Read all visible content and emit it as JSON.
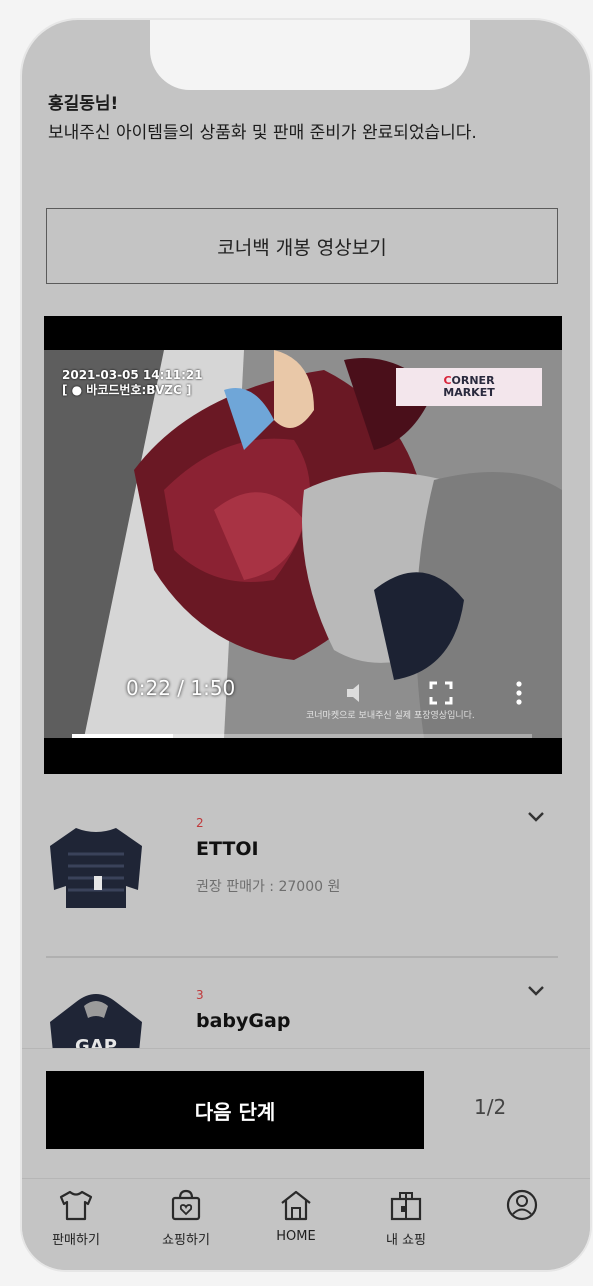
{
  "greeting": {
    "name": "홍길동님!",
    "message": "보내주신 아이템들의 상품화 및 판매 준비가 완료되었습니다."
  },
  "video_link_label": "코너백 개봉 영상보기",
  "video": {
    "timestamp": "2021-03-05 14:11:21",
    "barcode": "[ ● 바코드번호:BVZC ]",
    "brand_first": "C",
    "brand_rest": "ORNER",
    "brand_second": "MARKET",
    "time": "0:22 / 1:50",
    "caption": "코너마켓으로 보내주신 실제 포장영상입니다.",
    "progress": 0.22
  },
  "items": [
    {
      "number": "2",
      "brand": "ETTOI",
      "price": "권장 판매가 : 27000 원"
    },
    {
      "number": "3",
      "brand": "babyGap"
    }
  ],
  "next_button_label": "다음 단계",
  "page_indicator": "1/2",
  "tabs": [
    {
      "label": "판매하기",
      "icon": "tshirt-icon"
    },
    {
      "label": "쇼핑하기",
      "icon": "shopping-bag-icon"
    },
    {
      "label": "HOME",
      "icon": "home-icon"
    },
    {
      "label": "내 쇼핑",
      "icon": "gift-bag-icon"
    },
    {
      "label": "",
      "icon": "user-circle-icon"
    }
  ],
  "colors": {
    "background": "#c4c4c4",
    "button": "#000000",
    "accent": "#c0393b"
  }
}
